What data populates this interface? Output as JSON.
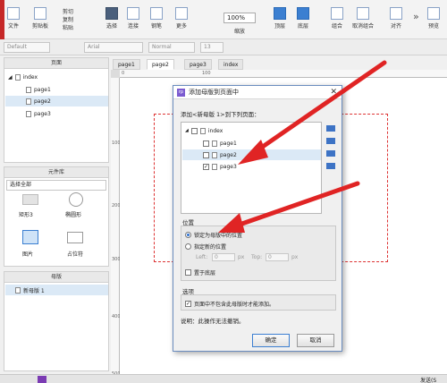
{
  "toolbar": {
    "left_labels": [
      "文件",
      "剪贴板"
    ],
    "small_items": [
      "剪切",
      "复制",
      "粘贴"
    ],
    "buttons": [
      "选择",
      "连接",
      "钢笔",
      "更多"
    ],
    "zoom": "100%",
    "zoom_label": "缩放",
    "right_buttons": [
      "顶层",
      "底层",
      "组合",
      "取消组合",
      "对齐",
      "预览"
    ]
  },
  "stylebar": {
    "style": "Default",
    "font": "Arial",
    "weight": "Normal",
    "size": "13"
  },
  "pages_panel": {
    "title": "页面",
    "items": [
      "index",
      "page1",
      "page2",
      "page3"
    ],
    "selected": "page2"
  },
  "widgets_panel": {
    "title": "元件库",
    "filter": "选择全部",
    "items": [
      "矩形3",
      "椭圆形",
      "图片",
      "占位符"
    ]
  },
  "masters_panel": {
    "title": "母版",
    "items": [
      "新母版 1"
    ]
  },
  "tabs": [
    "page1",
    "page2",
    "page3",
    "index"
  ],
  "active_tab": "page2",
  "rulers": {
    "h": [
      "0",
      "100"
    ],
    "v": [
      "100",
      "200",
      "300",
      "400",
      "500"
    ]
  },
  "dialog": {
    "title": "添加母版到页面中",
    "instruction": "添加<新母版 1>到下列页面：",
    "tree": [
      {
        "label": "index",
        "checked": false
      },
      {
        "label": "page1",
        "checked": false
      },
      {
        "label": "page2",
        "checked": false
      },
      {
        "label": "page3",
        "checked": true
      }
    ],
    "position_title": "位置",
    "option_lock": "锁定为母版中的位置",
    "option_custom": "指定新的位置",
    "left_label": "Left:",
    "top_label": "Top:",
    "left_value": "0",
    "top_value": "0",
    "unit": "px",
    "bottom_layer": "置于底层",
    "options_title": "选项",
    "only_add": "页面中不包含此母版时才能添加。",
    "note": "说明：此操作无法撤销。",
    "ok": "确定",
    "cancel": "取消"
  },
  "status": {
    "right": "发送(S"
  },
  "colors": {
    "arrow": "#e02424",
    "accent": "#3b7fd1"
  }
}
